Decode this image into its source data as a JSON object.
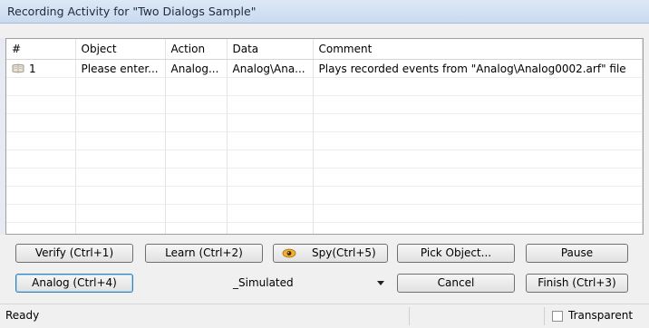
{
  "window": {
    "title": "Recording Activity for \"Two Dialogs Sample\""
  },
  "grid": {
    "columns": [
      "#",
      "Object",
      "Action",
      "Data",
      "Comment"
    ],
    "rows": [
      {
        "num": "1",
        "object": "Please enter...",
        "action": "Analog...",
        "data": "Analog\\Ana...",
        "comment": "Plays recorded events from \"Analog\\Analog0002.arf\" file",
        "icon": "recorded-event-icon"
      }
    ]
  },
  "buttons": {
    "verify": "Verify (Ctrl+1)",
    "learn": "Learn (Ctrl+2)",
    "spy": "Spy(Ctrl+5)",
    "pick": "Pick Object...",
    "pause": "Pause",
    "analog": "Analog (Ctrl+4)",
    "cancel": "Cancel",
    "finish": "Finish (Ctrl+3)"
  },
  "mode_dropdown": {
    "selected": "_Simulated"
  },
  "status": {
    "text": "Ready",
    "transparent_label": "Transparent",
    "transparent_checked": false
  },
  "icons": {
    "spy": "spy-eye-icon",
    "dropdown": "chevron-down-icon"
  }
}
